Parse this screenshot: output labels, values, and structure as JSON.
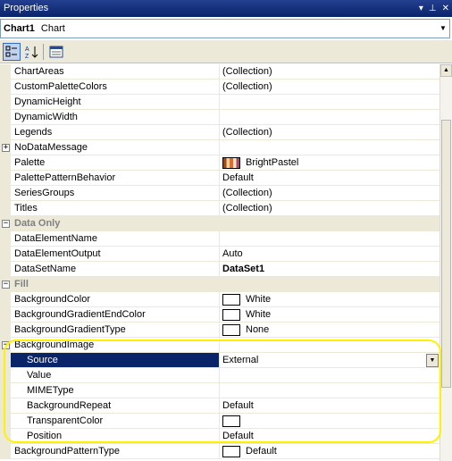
{
  "window": {
    "title": "Properties",
    "pin_glyph": "▾ ⮟ ✖"
  },
  "object_selector": {
    "name": "Chart1",
    "type": "Chart"
  },
  "toolbar": {
    "categorized_tip": "Categorized",
    "alpha_tip": "Alphabetical",
    "pages_tip": "Property Pages"
  },
  "rows": [
    {
      "kind": "prop",
      "name": "ChartAreas",
      "value": "(Collection)"
    },
    {
      "kind": "prop",
      "name": "CustomPaletteColors",
      "value": "(Collection)"
    },
    {
      "kind": "prop",
      "name": "DynamicHeight",
      "value": ""
    },
    {
      "kind": "prop",
      "name": "DynamicWidth",
      "value": ""
    },
    {
      "kind": "prop",
      "name": "Legends",
      "value": "(Collection)"
    },
    {
      "kind": "prop",
      "name": "NoDataMessage",
      "value": "",
      "expander": "+"
    },
    {
      "kind": "prop",
      "name": "Palette",
      "value": "BrightPastel",
      "swatch": "palette"
    },
    {
      "kind": "prop",
      "name": "PalettePatternBehavior",
      "value": "Default"
    },
    {
      "kind": "prop",
      "name": "SeriesGroups",
      "value": "(Collection)"
    },
    {
      "kind": "prop",
      "name": "Titles",
      "value": "(Collection)"
    },
    {
      "kind": "cat",
      "name": "Data Only",
      "expander": "−"
    },
    {
      "kind": "prop",
      "name": "DataElementName",
      "value": ""
    },
    {
      "kind": "prop",
      "name": "DataElementOutput",
      "value": "Auto"
    },
    {
      "kind": "prop",
      "name": "DataSetName",
      "value": "DataSet1",
      "bold": true
    },
    {
      "kind": "cat",
      "name": "Fill",
      "expander": "−"
    },
    {
      "kind": "prop",
      "name": "BackgroundColor",
      "value": "White",
      "swatch": "white"
    },
    {
      "kind": "prop",
      "name": "BackgroundGradientEndColor",
      "value": "White",
      "swatch": "white"
    },
    {
      "kind": "prop",
      "name": "BackgroundGradientType",
      "value": "None",
      "swatch": "white"
    },
    {
      "kind": "prop",
      "name": "BackgroundImage",
      "value": "",
      "expander": "−"
    },
    {
      "kind": "prop",
      "name": "Source",
      "value": "External",
      "child": true,
      "selected": true,
      "dropdown": true
    },
    {
      "kind": "prop",
      "name": "Value",
      "value": "",
      "child": true
    },
    {
      "kind": "prop",
      "name": "MIMEType",
      "value": "",
      "child": true
    },
    {
      "kind": "prop",
      "name": "BackgroundRepeat",
      "value": "Default",
      "child": true
    },
    {
      "kind": "prop",
      "name": "TransparentColor",
      "value": "",
      "child": true,
      "swatch": "white"
    },
    {
      "kind": "prop",
      "name": "Position",
      "value": "Default",
      "child": true
    },
    {
      "kind": "prop",
      "name": "BackgroundPatternType",
      "value": "Default",
      "swatch": "white"
    }
  ],
  "colors": {
    "title_bar": "#0a246a",
    "selection": "#0a246a",
    "category_bg": "#ece9d8",
    "annotation": "#fff200"
  }
}
